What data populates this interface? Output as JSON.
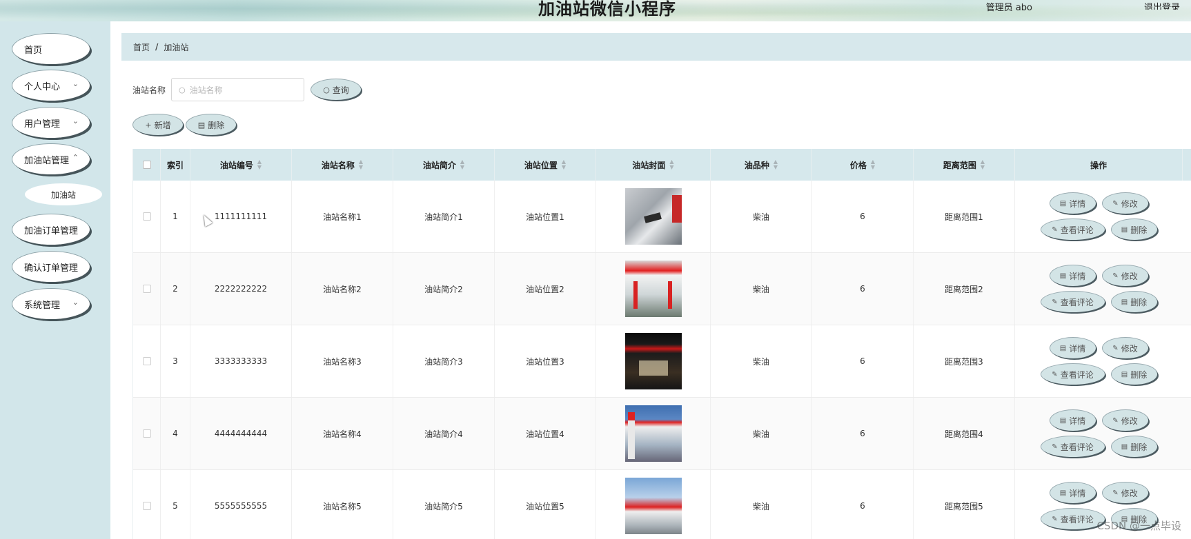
{
  "header": {
    "site_title": "加油站微信小程序",
    "user": "管理员 abo",
    "logout": "退出登录"
  },
  "sidebar": {
    "items": [
      {
        "label": "首页",
        "expandable": false
      },
      {
        "label": "个人中心",
        "expandable": true
      },
      {
        "label": "用户管理",
        "expandable": true
      },
      {
        "label": "加油站管理",
        "expandable": true
      },
      {
        "label": "加油订单管理",
        "expandable": false
      },
      {
        "label": "确认订单管理",
        "expandable": false
      },
      {
        "label": "系统管理",
        "expandable": true
      }
    ],
    "subitem": {
      "label": "加油站",
      "parent": "加油站管理"
    }
  },
  "breadcrumb": {
    "home": "首页",
    "separator": "/",
    "current": "加油站"
  },
  "search": {
    "label": "油站名称",
    "placeholder": "油站名称",
    "query_button": "查询"
  },
  "toolbar": {
    "add_label": "新增",
    "delete_label": "删除"
  },
  "table": {
    "columns": [
      "索引",
      "油站编号",
      "油站名称",
      "油站简介",
      "油站位置",
      "油站封面",
      "油品种",
      "价格",
      "距离范围",
      "操作"
    ],
    "rows": [
      {
        "index": "1",
        "code": "1111111111",
        "name": "油站名称1",
        "intro": "油站简介1",
        "location": "油站位置1",
        "fuel": "柴油",
        "price": "6",
        "range": "距离范围1"
      },
      {
        "index": "2",
        "code": "2222222222",
        "name": "油站名称2",
        "intro": "油站简介2",
        "location": "油站位置2",
        "fuel": "柴油",
        "price": "6",
        "range": "距离范围2"
      },
      {
        "index": "3",
        "code": "3333333333",
        "name": "油站名称3",
        "intro": "油站简介3",
        "location": "油站位置3",
        "fuel": "柴油",
        "price": "6",
        "range": "距离范围3"
      },
      {
        "index": "4",
        "code": "4444444444",
        "name": "油站名称4",
        "intro": "油站简介4",
        "location": "油站位置4",
        "fuel": "柴油",
        "price": "6",
        "range": "距离范围4"
      },
      {
        "index": "5",
        "code": "5555555555",
        "name": "油站名称5",
        "intro": "油站简介5",
        "location": "油站位置5",
        "fuel": "柴油",
        "price": "6",
        "range": "距离范围5"
      }
    ],
    "actions": {
      "detail": "详情",
      "edit": "修改",
      "comments": "查看评论",
      "delete": "删除"
    }
  },
  "watermark": "CSDN @一点毕设",
  "colors": {
    "sidebar_bg": "#d2e6ea",
    "header_row_bg": "#d6e8ec",
    "button_bg": "#d3e4e6"
  }
}
